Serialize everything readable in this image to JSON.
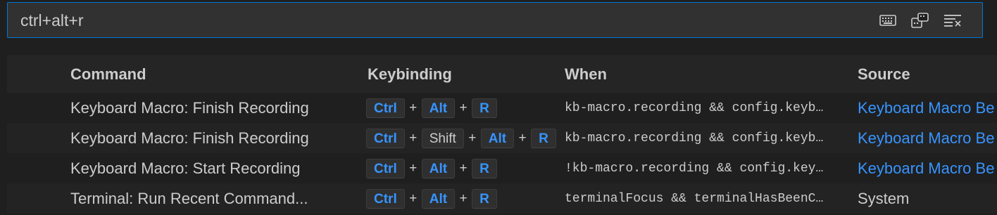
{
  "search": {
    "value": "ctrl+alt+r",
    "icons": [
      "keyboard-icon",
      "record-keys-icon",
      "clear-filter-icon"
    ]
  },
  "columns": {
    "command": "Command",
    "keybinding": "Keybinding",
    "when": "When",
    "source": "Source"
  },
  "rows": [
    {
      "command": "Keyboard Macro: Finish Recording",
      "keys": [
        "Ctrl",
        "+",
        "Alt",
        "+",
        "R"
      ],
      "when": "kb-macro.recording && config.keyb…",
      "source": "Keyboard Macro Be",
      "source_is_link": true
    },
    {
      "command": "Keyboard Macro: Finish Recording",
      "keys": [
        "Ctrl",
        "+",
        "Shift",
        "+",
        "Alt",
        "+",
        "R"
      ],
      "when": "kb-macro.recording && config.keyb…",
      "source": "Keyboard Macro Be",
      "source_is_link": true
    },
    {
      "command": "Keyboard Macro: Start Recording",
      "keys": [
        "Ctrl",
        "+",
        "Alt",
        "+",
        "R"
      ],
      "when": "!kb-macro.recording && config.key…",
      "source": "Keyboard Macro Be",
      "source_is_link": true
    },
    {
      "command": "Terminal: Run Recent Command...",
      "keys": [
        "Ctrl",
        "+",
        "Alt",
        "+",
        "R"
      ],
      "when": "terminalFocus && terminalHasBeenC…",
      "source": "System",
      "source_is_link": false
    }
  ],
  "colors": {
    "accent": "#0078d4",
    "key_text": "#3794ff",
    "link": "#3794ff"
  }
}
